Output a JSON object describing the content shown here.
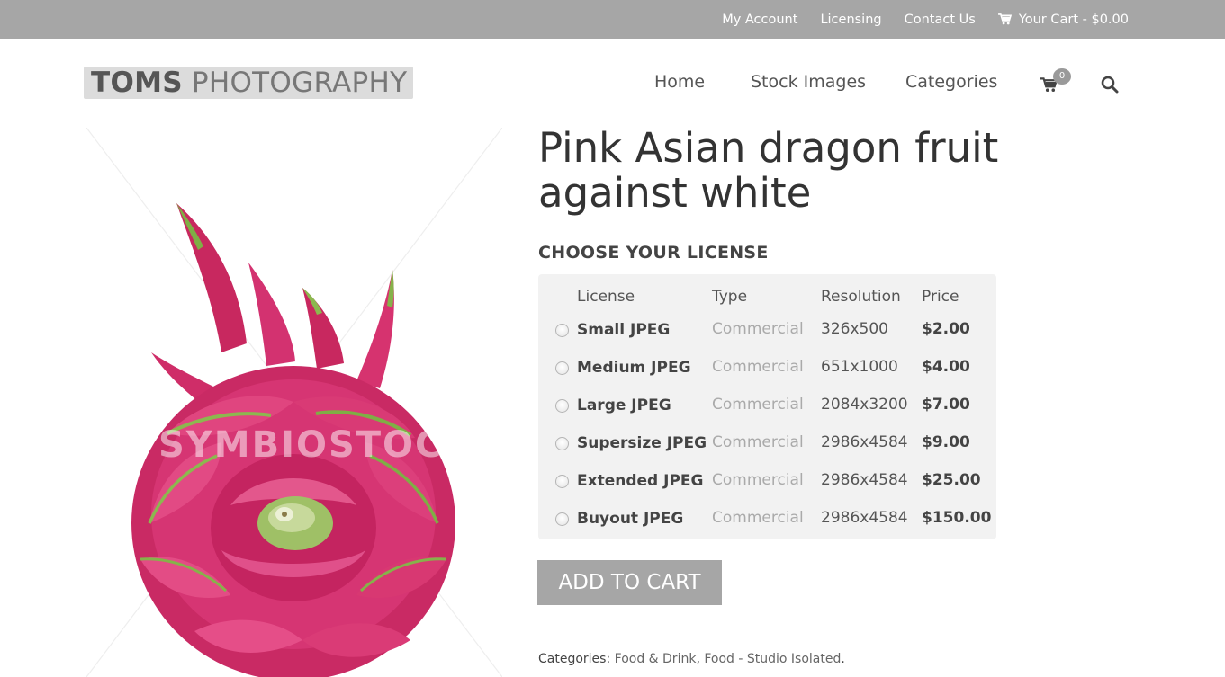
{
  "topbar": {
    "links": [
      {
        "label": "My Account"
      },
      {
        "label": "Licensing"
      },
      {
        "label": "Contact Us"
      },
      {
        "label": "Your Cart - $0.00"
      }
    ]
  },
  "header": {
    "logo_bold": "TOMS",
    "logo_light": "PHOTOGRAPHY",
    "nav": [
      {
        "label": "Home"
      },
      {
        "label": "Stock Images"
      },
      {
        "label": "Categories"
      }
    ],
    "cart_count": "0"
  },
  "product": {
    "watermark": "SYMBIOSTOCK",
    "title": "Pink Asian dragon fruit against white",
    "choose_heading": "CHOOSE YOUR LICENSE",
    "table_headers": {
      "license": "License",
      "type": "Type",
      "resolution": "Resolution",
      "price": "Price"
    },
    "licenses": [
      {
        "name": "Small JPEG",
        "type": "Commercial",
        "resolution": "326x500",
        "price": "$2.00"
      },
      {
        "name": "Medium JPEG",
        "type": "Commercial",
        "resolution": "651x1000",
        "price": "$4.00"
      },
      {
        "name": "Large JPEG",
        "type": "Commercial",
        "resolution": "2084x3200",
        "price": "$7.00"
      },
      {
        "name": "Supersize JPEG",
        "type": "Commercial",
        "resolution": "2986x4584",
        "price": "$9.00"
      },
      {
        "name": "Extended JPEG",
        "type": "Commercial",
        "resolution": "2986x4584",
        "price": "$25.00"
      },
      {
        "name": "Buyout JPEG",
        "type": "Commercial",
        "resolution": "2986x4584",
        "price": "$150.00"
      }
    ],
    "add_to_cart": "ADD TO CART",
    "categories_label": "Categories:",
    "categories": [
      {
        "label": "Food & Drink"
      },
      {
        "label": "Food - Studio Isolated"
      }
    ]
  },
  "colors": {
    "topbar_bg": "#a6a6a6",
    "button_bg": "#a6a6a6",
    "license_box_bg": "#f2f2f2",
    "fruit_pink": "#d12f6b",
    "fruit_green": "#7fae45"
  },
  "icons": {
    "cart": "cart-icon",
    "search": "search-icon",
    "radio": "radio-button"
  }
}
